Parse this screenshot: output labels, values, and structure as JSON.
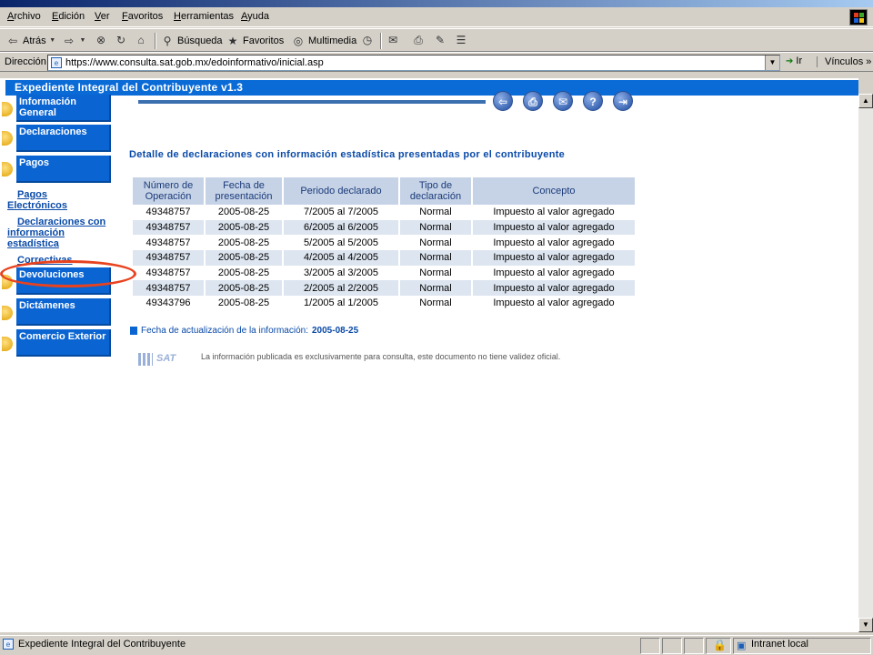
{
  "menubar": {
    "items": [
      "Archivo",
      "Edición",
      "Ver",
      "Favoritos",
      "Herramientas",
      "Ayuda"
    ]
  },
  "toolbar": {
    "back_label": "Atrás",
    "search_label": "Búsqueda",
    "favorites_label": "Favoritos",
    "multimedia_label": "Multimedia"
  },
  "address": {
    "label": "Dirección",
    "url": "https://www.consulta.sat.gob.mx/edoinformativo/inicial.asp",
    "go_label": "Ir",
    "links_label": "Vínculos »"
  },
  "page": {
    "header": "Expediente Integral del Contribuyente v1.3",
    "title": "Detalle de declaraciones con información estadística presentadas por el contribuyente",
    "update_label": "Fecha de actualización de la información:",
    "update_date": "2005-08-25",
    "sat_logo": "SAT",
    "disclaimer": "La información publicada es exclusivamente para consulta, este documento no tiene validez oficial."
  },
  "nav": {
    "info_general": "Información General",
    "declaraciones": "Declaraciones",
    "pagos": "Pagos",
    "sub_pagos": "Pagos Electrónicos",
    "sub_decl": "Declaraciones con información estadística",
    "sub_correctivas": "Correctivas",
    "devoluciones": "Devoluciones",
    "dictamenes": "Dictámenes",
    "comercio": "Comercio Exterior"
  },
  "table": {
    "headers": [
      "Número de Operación",
      "Fecha de presentación",
      "Periodo declarado",
      "Tipo de declaración",
      "Concepto"
    ],
    "rows": [
      [
        "49348757",
        "2005-08-25",
        "7/2005 al 7/2005",
        "Normal",
        "Impuesto al valor agregado"
      ],
      [
        "49348757",
        "2005-08-25",
        "6/2005 al 6/2005",
        "Normal",
        "Impuesto al valor agregado"
      ],
      [
        "49348757",
        "2005-08-25",
        "5/2005 al 5/2005",
        "Normal",
        "Impuesto al valor agregado"
      ],
      [
        "49348757",
        "2005-08-25",
        "4/2005 al 4/2005",
        "Normal",
        "Impuesto al valor agregado"
      ],
      [
        "49348757",
        "2005-08-25",
        "3/2005 al 3/2005",
        "Normal",
        "Impuesto al valor agregado"
      ],
      [
        "49348757",
        "2005-08-25",
        "2/2005 al 2/2005",
        "Normal",
        "Impuesto al valor agregado"
      ],
      [
        "49343796",
        "2005-08-25",
        "1/2005 al 1/2005",
        "Normal",
        "Impuesto al valor agregado"
      ]
    ]
  },
  "statusbar": {
    "text": "Expediente Integral del Contribuyente",
    "zone": "Intranet local"
  },
  "colors": {
    "nav_blue": "#0a64d2",
    "header_blue": "#0a6bd6",
    "link_blue": "#0a4aa8",
    "annotation_red": "#e8421e"
  }
}
